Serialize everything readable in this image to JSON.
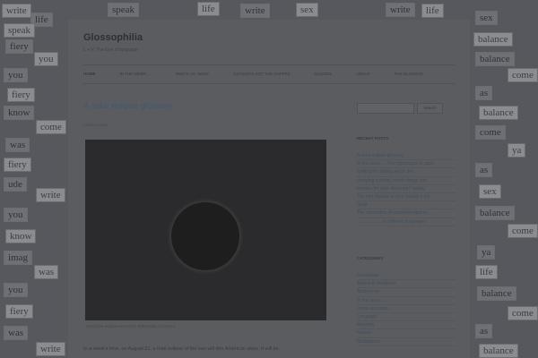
{
  "site": {
    "title": "Glossophilia",
    "description": "L + V: The love of language"
  },
  "nav": [
    {
      "label": "HOME"
    },
    {
      "label": "IN THE NEWS …"
    },
    {
      "label": "WHO'S VS. WHAT"
    },
    {
      "label": "GLOSSO'S GOT THE GAFFES"
    },
    {
      "label": "QUIZZES"
    },
    {
      "label": "ABOUT"
    },
    {
      "label": "THE GLOSSOS"
    }
  ],
  "post": {
    "title": "A solar eclipse glossary",
    "leave_reply": "Leave a reply",
    "caption": "Total solar eclipse seen from Wikimedia Commons",
    "body": "In a week's time, on August 21, a total eclipse of the sun will dim American skies. It will be"
  },
  "search": {
    "button": "Search"
  },
  "recent_posts": {
    "heading": "RECENT POSTS",
    "items": [
      "A solar eclipse glossary",
      "In the news … The importance of good",
      "spelling for dating and in the",
      "dropping subway, words things and",
      "females for sale: Amazing? webby",
      "The mid-Atlantic accent: plainly it not",
      "Spelt",
      "The discomfort of unspoken spaces …",
      "…………….. in different languages"
    ]
  },
  "categories": {
    "heading": "CATEGORIES",
    "items": [
      "Accentuate",
      "Aphids & Headlines",
      "Anathemas",
      "In the news …",
      "Jokes and puns",
      "Language",
      "Meaning",
      "Names",
      "Neologisms"
    ]
  },
  "background_words": [
    "write",
    "life",
    "sex",
    "speak",
    "fiery",
    "you",
    "know",
    "balance",
    "come",
    "was",
    "imag",
    "ude",
    "ya",
    "as",
    "life",
    "write",
    "balance",
    "come",
    "was",
    "you",
    "fiery",
    "know",
    "sex",
    "speak"
  ]
}
